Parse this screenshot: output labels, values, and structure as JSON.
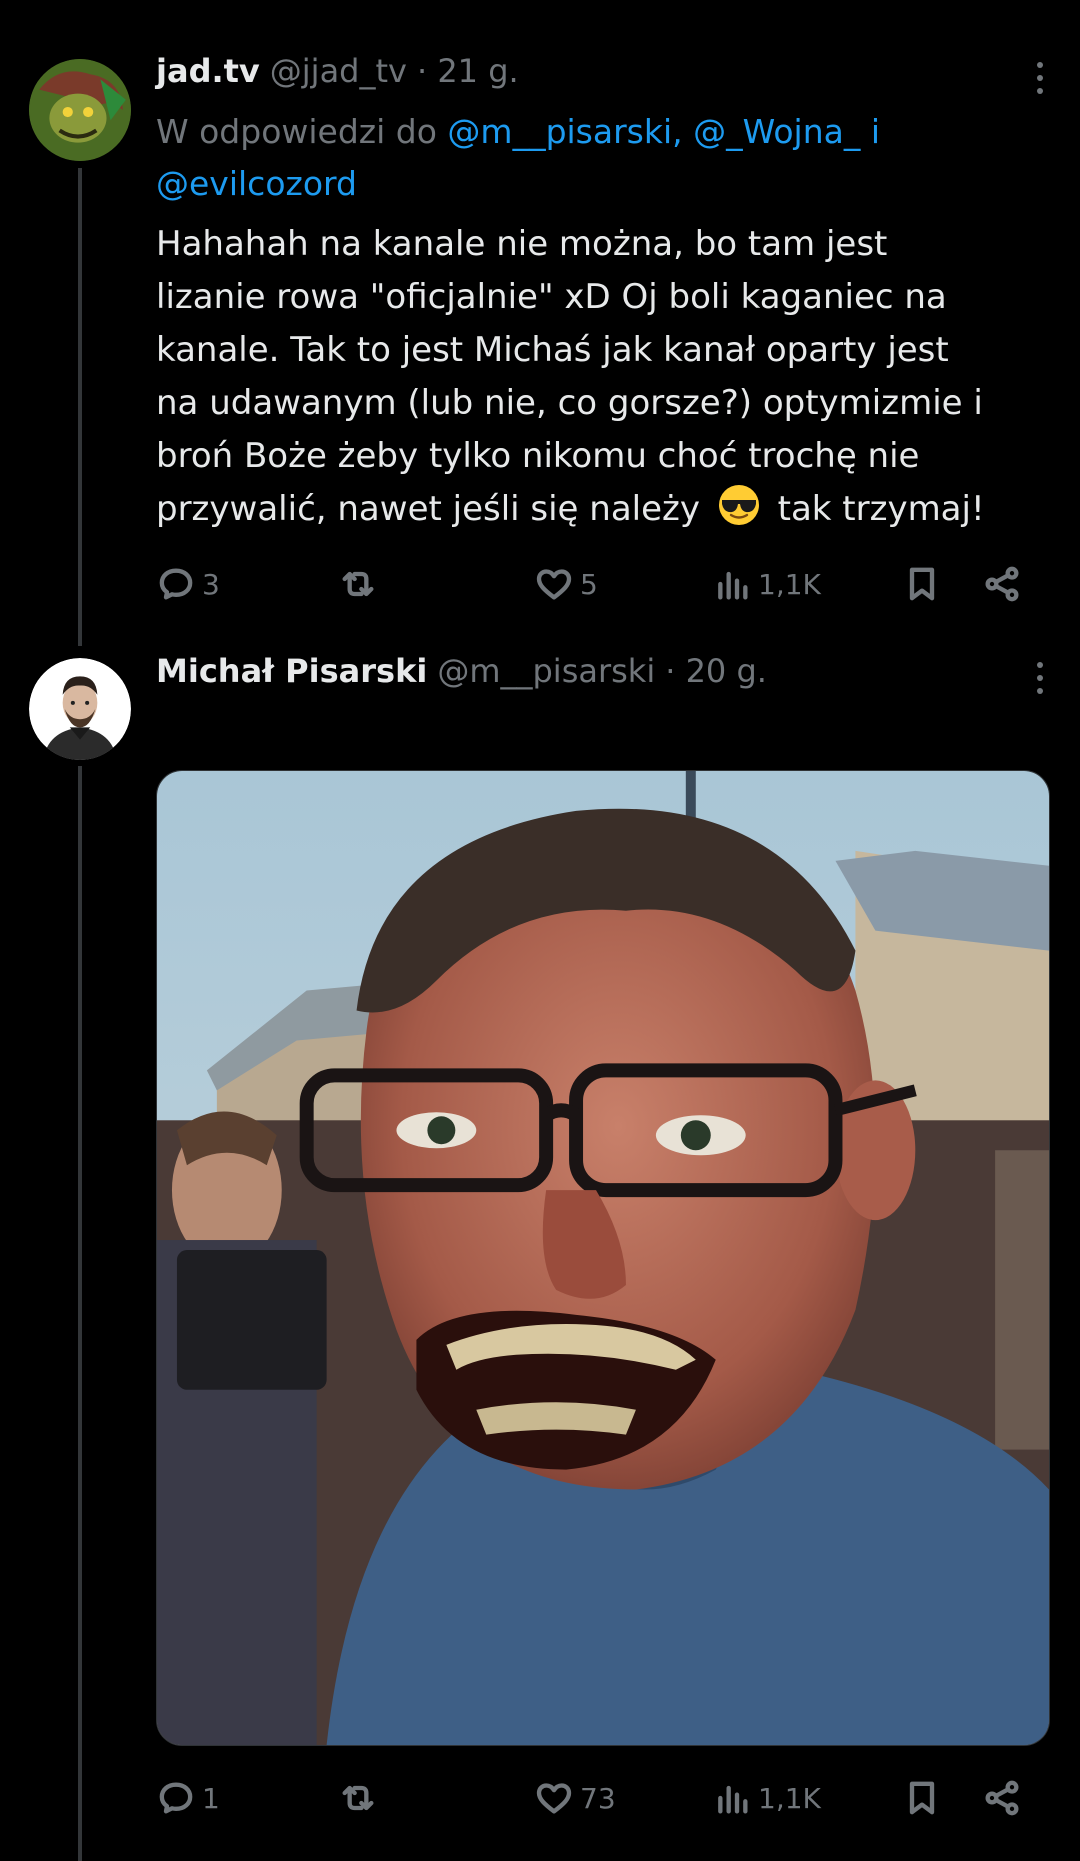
{
  "tweets": [
    {
      "name": "jad.tv",
      "handle": "@jjad_tv",
      "time": "· 21 g.",
      "reply_prefix": "W odpowiedzi do",
      "mentions": [
        "@m__pisarski,",
        "@_Wojna_",
        "i",
        "@evilcozord"
      ],
      "text_line1": "Hahahah na kanale nie można, bo tam jest",
      "text_line2": "lizanie rowa \"oficjalnie\" xD Oj boli kaganiec na",
      "text_line3": "kanale. Tak to jest Michaś jak kanał oparty jest",
      "text_line4": "na udawanym (lub nie, co gorsze?) optymizmie i",
      "text_line5": "broń Boże żeby tylko nikomu choć trochę nie",
      "text_line6a": "przywalić, nawet jeśli się należy",
      "text_line6b": "tak trzymaj!",
      "emoji": "smiling-face-with-sunglasses",
      "stats": {
        "replies": "3",
        "reposts": "",
        "likes": "5",
        "views": "1,1K"
      }
    },
    {
      "name": "Michał Pisarski",
      "handle": "@m__pisarski",
      "time": "· 20 g.",
      "stats": {
        "replies": "1",
        "reposts": "",
        "likes": "73",
        "views": "1,1K"
      }
    }
  ],
  "colors": {
    "background": "#000000",
    "text": "#e7e9ea",
    "muted": "#71767b",
    "link": "#1d9bf0",
    "divider": "#333639"
  }
}
